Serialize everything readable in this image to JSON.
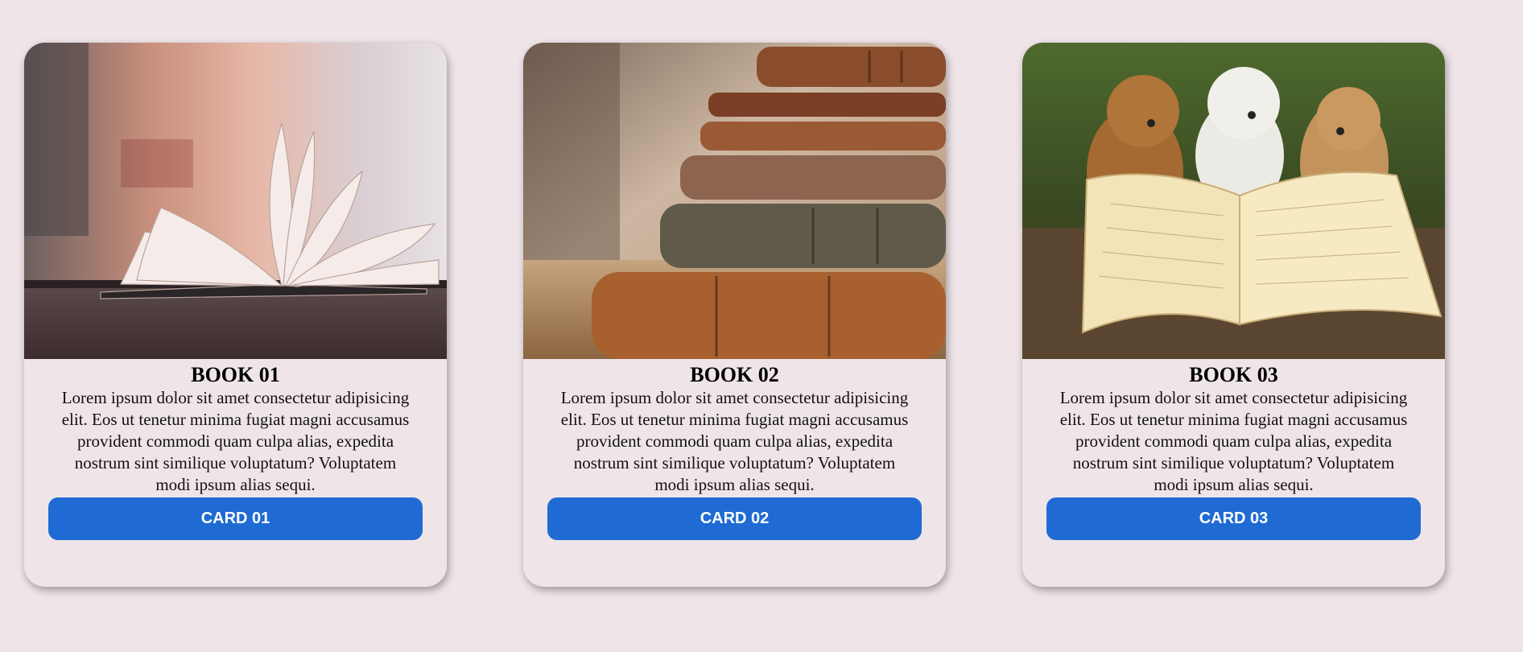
{
  "cards": [
    {
      "title": "BOOK 01",
      "description": "Lorem ipsum dolor sit amet consectetur adipisicing elit. Eos ut tenetur minima fugiat magni accusamus provident commodi quam culpa alias, expedita nostrum sint similique voluptatum? Voluptatem modi ipsum alias sequi.",
      "button_label": "CARD 01",
      "image": "open-book-on-table-photo"
    },
    {
      "title": "BOOK 02",
      "description": "Lorem ipsum dolor sit amet consectetur adipisicing elit. Eos ut tenetur minima fugiat magni accusamus provident commodi quam culpa alias, expedita nostrum sint similique voluptatum? Voluptatem modi ipsum alias sequi.",
      "button_label": "CARD 02",
      "image": "stack-of-old-books-photo"
    },
    {
      "title": "BOOK 03",
      "description": "Lorem ipsum dolor sit amet consectetur adipisicing elit. Eos ut tenetur minima fugiat magni accusamus provident commodi quam culpa alias, expedita nostrum sint similique voluptatum? Voluptatem modi ipsum alias sequi.",
      "button_label": "CARD 03",
      "image": "teddy-bears-reading-book-photo"
    }
  ],
  "colors": {
    "background": "#efe5e9",
    "button": "#1f6bd3",
    "button_text": "#ffffff"
  }
}
